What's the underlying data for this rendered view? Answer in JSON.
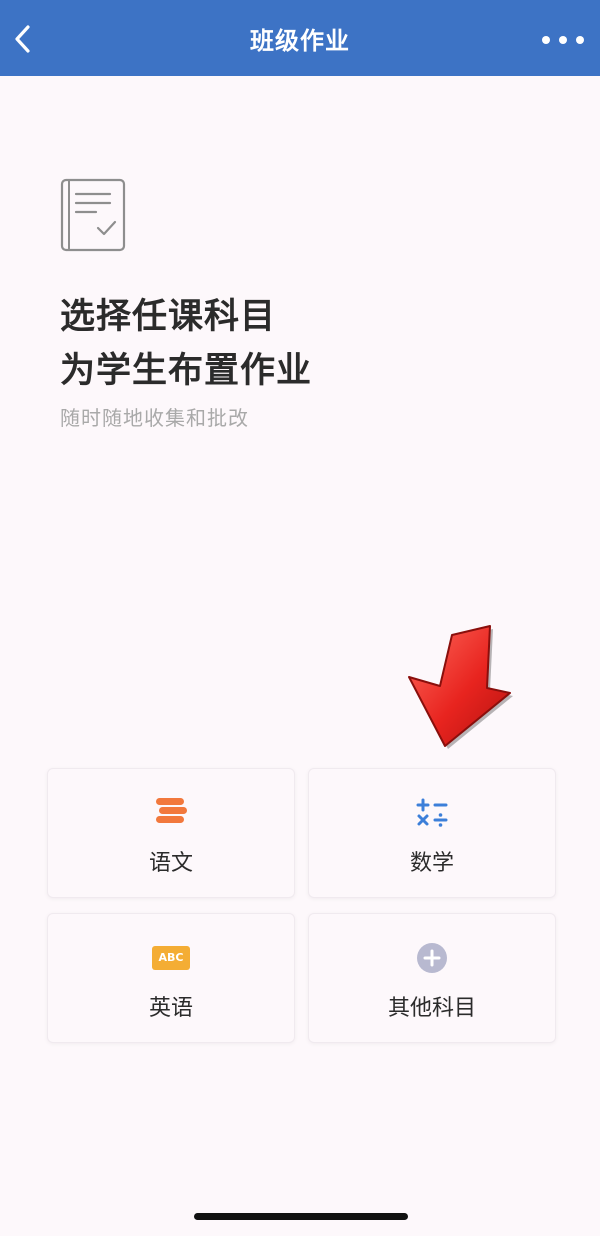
{
  "navbar": {
    "title": "班级作业",
    "back_icon": "chevron-left-icon",
    "more_icon": "more-dots-icon",
    "color": "#3d73c5"
  },
  "intro": {
    "icon": "document-check-icon",
    "headline_line1": "选择任课科目",
    "headline_line2": "为学生布置作业",
    "subtitle": "随时随地收集和批改"
  },
  "overlay": {
    "icon": "red-arrow-down-icon",
    "color": "#e8241f"
  },
  "subjects": [
    {
      "label": "语文",
      "icon": "books-stack-icon",
      "icon_color": "#f2783c"
    },
    {
      "label": "数学",
      "icon": "math-symbols-icon",
      "icon_color": "#3c7fd9"
    },
    {
      "label": "英语",
      "icon": "abc-icon",
      "icon_text": "ABC",
      "icon_color": "#f4ad34"
    },
    {
      "label": "其他科目",
      "icon": "plus-circle-icon",
      "icon_color": "#b8b9d0"
    }
  ]
}
